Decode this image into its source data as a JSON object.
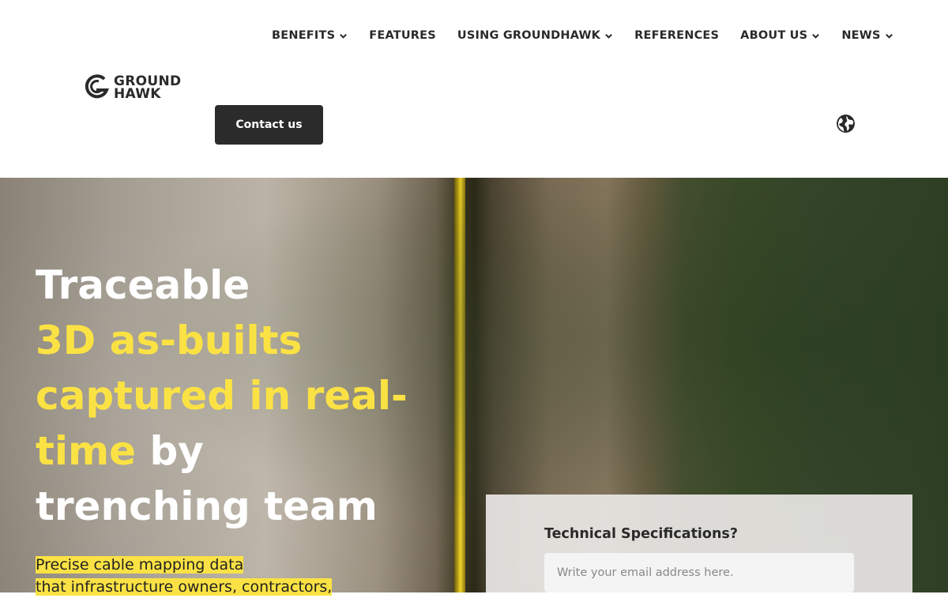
{
  "nav": {
    "items": [
      {
        "label": "BENEFITS",
        "has_dropdown": true
      },
      {
        "label": "FEATURES",
        "has_dropdown": false
      },
      {
        "label": "USING GROUNDHAWK",
        "has_dropdown": true
      },
      {
        "label": "REFERENCES",
        "has_dropdown": false
      },
      {
        "label": "ABOUT US",
        "has_dropdown": true
      },
      {
        "label": "NEWS",
        "has_dropdown": true
      }
    ]
  },
  "logo": {
    "line1": "GROUND",
    "line2": "HAWK",
    "icon": "groundhawk-logo-icon"
  },
  "header": {
    "contact_label": "Contact us",
    "language_icon": "globe-icon"
  },
  "hero": {
    "title_line1": "Traceable",
    "title_highlight": "3D as-builts captured in real-time",
    "title_by": "by",
    "title_rest": "trenching team",
    "subtitle_line1": "Precise cable mapping data",
    "subtitle_line2": "that infrastructure owners, contractors,",
    "accent_color": "#fbe244"
  },
  "spec_form": {
    "title": "Technical Specifications?",
    "email_placeholder": "Write your email address here."
  }
}
